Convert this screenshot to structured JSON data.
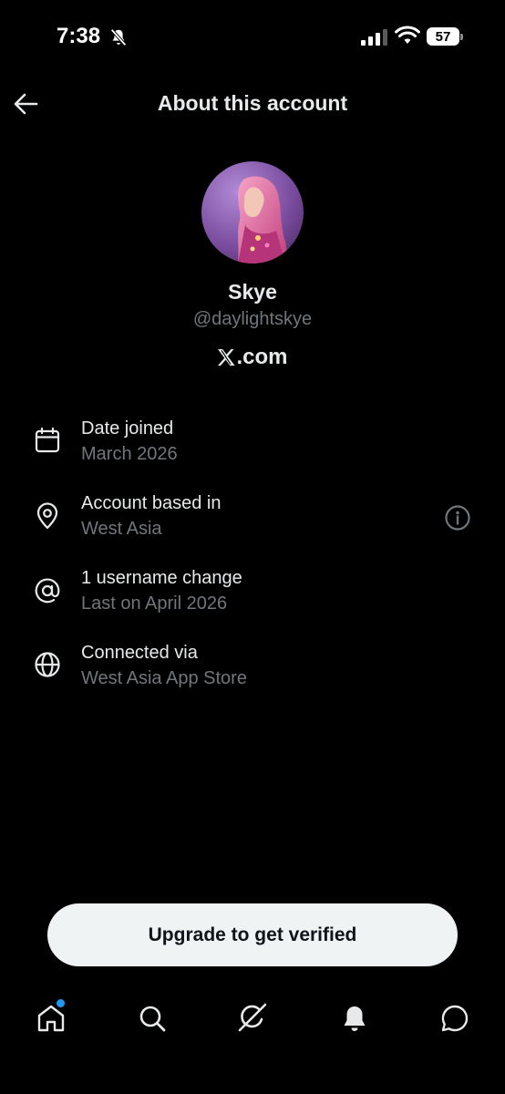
{
  "status_bar": {
    "time": "7:38",
    "battery": "57"
  },
  "header": {
    "title": "About this account"
  },
  "profile": {
    "name": "Skye",
    "handle": "@daylightskye",
    "source": ".com"
  },
  "info": [
    {
      "title": "Date joined",
      "value": "March 2026",
      "icon": "calendar-icon"
    },
    {
      "title": "Account based in",
      "value": "West Asia",
      "icon": "location-pin-icon"
    },
    {
      "title": "1 username change",
      "value": "Last on April 2026",
      "icon": "at-sign-icon"
    },
    {
      "title": "Connected via",
      "value": "West Asia App Store",
      "icon": "globe-icon"
    }
  ],
  "upgrade_label": "Upgrade to get verified",
  "nav": [
    "home-icon",
    "search-icon",
    "grok-icon",
    "notifications-icon",
    "messages-icon"
  ],
  "colors": {
    "background": "#000000",
    "primary_text": "#e7e9ea",
    "secondary_text": "#71767b",
    "accent_dot": "#1d9bf0",
    "button_bg": "#eff3f4"
  }
}
